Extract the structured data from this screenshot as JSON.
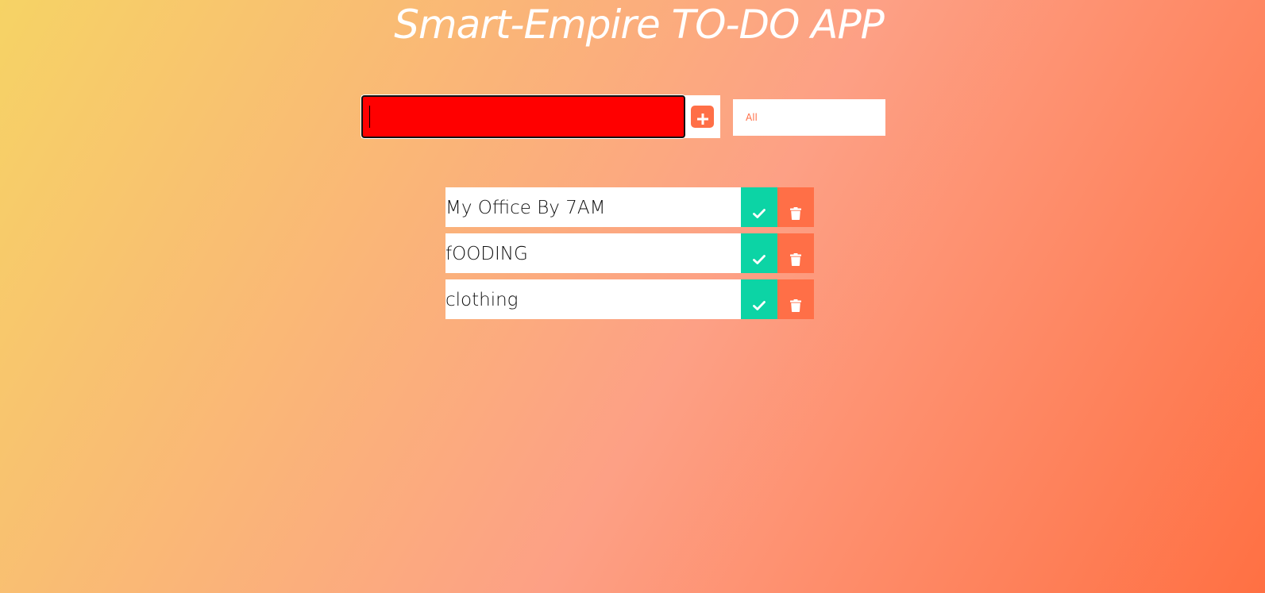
{
  "app": {
    "title": "Smart-Empire TO-DO APP"
  },
  "form": {
    "input_value": "",
    "add_icon": "plus-square-icon",
    "filter_selected": "All"
  },
  "todos": [
    {
      "text": "My Office By 7AM"
    },
    {
      "text": "fOODING"
    },
    {
      "text": "clothing"
    }
  ],
  "icons": {
    "complete": "check-icon",
    "delete": "trash-icon"
  },
  "colors": {
    "gradient_start": "#f6d365",
    "gradient_end": "#ff7043",
    "input_background": "#ff0000",
    "accent": "#ff6f47",
    "complete": "#0cd4a5",
    "text_light": "#ffffff"
  }
}
